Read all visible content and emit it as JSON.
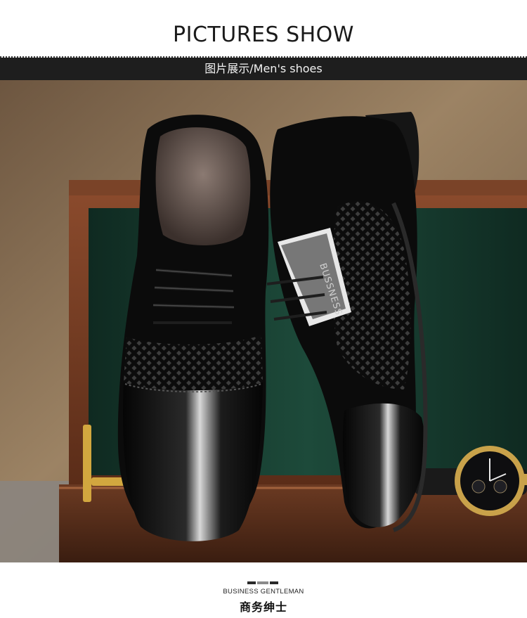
{
  "header": {
    "title": "PICTURES SHOW",
    "subtitle": "图片展示/Men's shoes"
  },
  "photo": {
    "shoe_brand_text": "BUSSNESS"
  },
  "footer": {
    "english": "BUSINESS GENTLEMAN",
    "chinese": "商务绅士"
  },
  "colors": {
    "band_background": "#1e1e1e",
    "shoe_leather": "#0b0b0b",
    "box_wood": "#7a4328",
    "box_felt": "#163a2e",
    "wall": "#8b7157",
    "watch_gold": "#c9a24a"
  }
}
